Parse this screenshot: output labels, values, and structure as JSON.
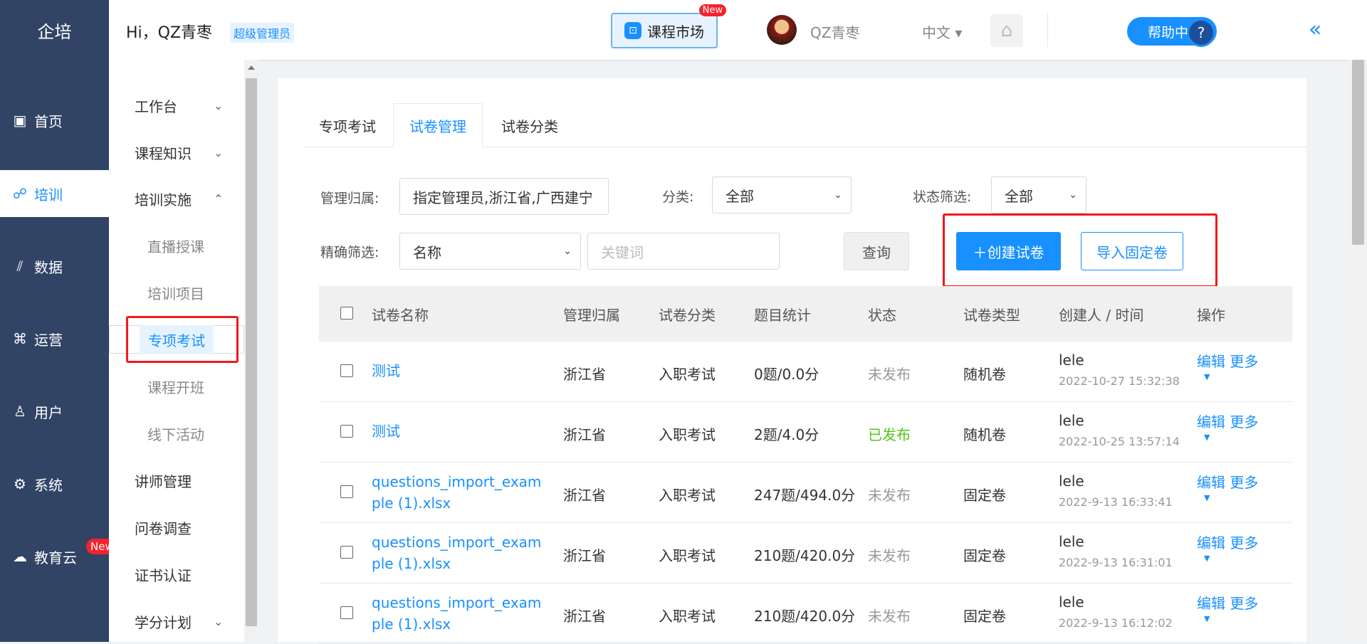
{
  "rail": {
    "logo": "企培",
    "items": [
      {
        "label": "首页",
        "icon": "dashboard-icon",
        "glyph": "▣"
      },
      {
        "label": "培训",
        "icon": "training-icon",
        "glyph": "☍"
      },
      {
        "label": "数据",
        "icon": "data-chart-icon",
        "glyph": "⫽"
      },
      {
        "label": "运营",
        "icon": "operations-icon",
        "glyph": "⌘"
      },
      {
        "label": "用户",
        "icon": "user-icon",
        "glyph": "♙"
      },
      {
        "label": "系统",
        "icon": "gear-icon",
        "glyph": "⚙"
      },
      {
        "label": "教育云",
        "icon": "cloud-icon",
        "glyph": "☁"
      }
    ],
    "new_badge": "New"
  },
  "header": {
    "greeting": "Hi，QZ青枣",
    "role": "超级管理员",
    "market_label": "课程市场",
    "market_badge": "New",
    "username": "QZ青枣",
    "language": "中文 ▾",
    "help_label": "帮助中心",
    "help_q": "?"
  },
  "sidebar": {
    "items": [
      "工作台",
      "课程知识",
      "培训实施",
      "直播授课",
      "培训项目",
      "专项考试",
      "课程开班",
      "线下活动",
      "讲师管理",
      "问卷调查",
      "证书认证",
      "学分计划"
    ]
  },
  "tabs": [
    "专项考试",
    "试卷管理",
    "试卷分类"
  ],
  "filters": {
    "owner_label": "管理归属:",
    "owner_value": "指定管理员,浙江省,广西建宁",
    "category_label": "分类:",
    "category_value": "全部",
    "status_label": "状态筛选:",
    "status_value": "全部",
    "precise_label": "精确筛选:",
    "precise_value": "名称",
    "keyword_placeholder": "关键词",
    "query_button": "查询",
    "create_button": "＋创建试卷",
    "import_button": "导入固定卷"
  },
  "table": {
    "headers": [
      "试卷名称",
      "管理归属",
      "试卷分类",
      "题目统计",
      "状态",
      "试卷类型",
      "创建人 / 时间",
      "操作"
    ],
    "rows": [
      {
        "name": "测试",
        "owner": "浙江省",
        "category": "入职考试",
        "stats": "0题/0.0分",
        "status": "未发布",
        "type": "随机卷",
        "creator": "lele",
        "time": "2022-10-27 15:32:38"
      },
      {
        "name": "测试",
        "owner": "浙江省",
        "category": "入职考试",
        "stats": "2题/4.0分",
        "status": "已发布",
        "type": "随机卷",
        "creator": "lele",
        "time": "2022-10-25 13:57:14"
      },
      {
        "name": "questions_import_example (1).xlsx",
        "owner": "浙江省",
        "category": "入职考试",
        "stats": "247题/494.0分",
        "status": "未发布",
        "type": "固定卷",
        "creator": "lele",
        "time": "2022-9-13 16:33:41"
      },
      {
        "name": "questions_import_example (1).xlsx",
        "owner": "浙江省",
        "category": "入职考试",
        "stats": "210题/420.0分",
        "status": "未发布",
        "type": "固定卷",
        "creator": "lele",
        "time": "2022-9-13 16:31:01"
      },
      {
        "name": "questions_import_example (1).xlsx",
        "owner": "浙江省",
        "category": "入职考试",
        "stats": "210题/420.0分",
        "status": "未发布",
        "type": "固定卷",
        "creator": "lele",
        "time": "2022-9-13 16:12:02"
      }
    ],
    "op_edit": "编辑",
    "op_more": "更多"
  }
}
